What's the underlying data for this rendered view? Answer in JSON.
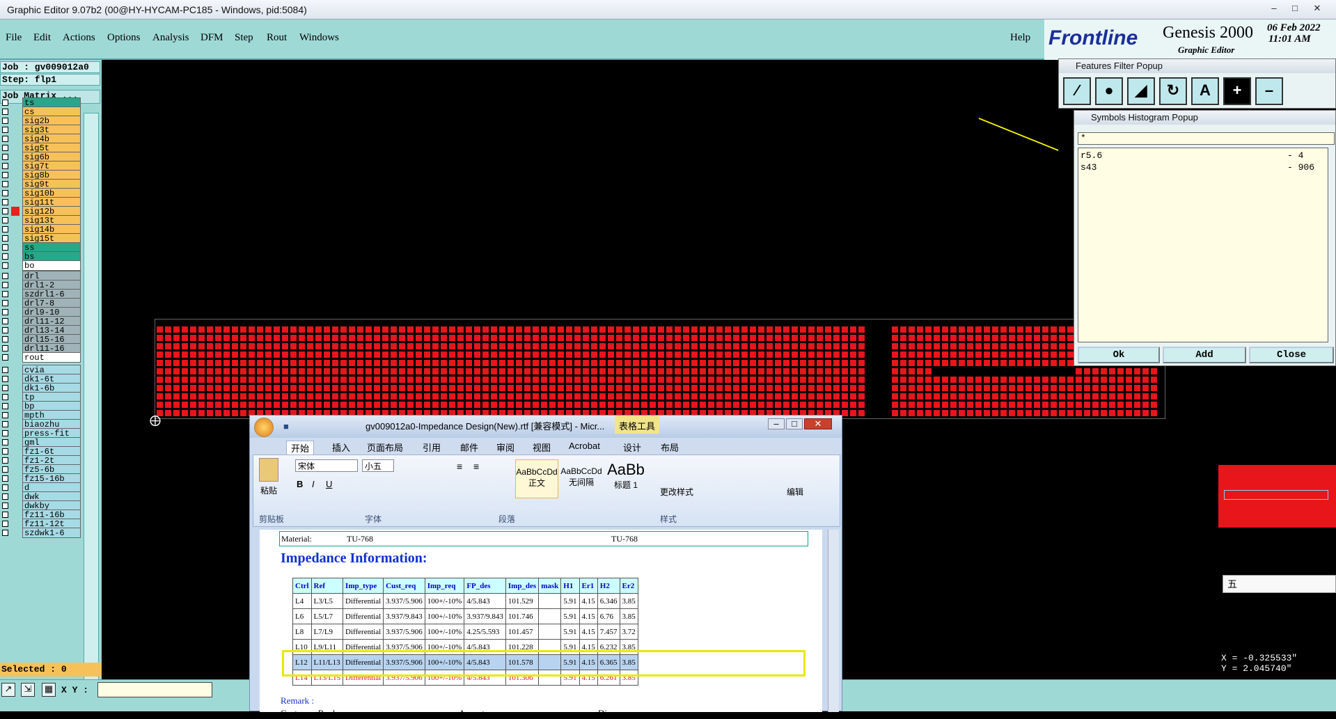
{
  "window": {
    "title": "Graphic Editor 9.07b2 (00@HY-HYCAM-PC185 - Windows, pid:5084)"
  },
  "menu": {
    "items": [
      "File",
      "Edit",
      "Actions",
      "Options",
      "Analysis",
      "DFM",
      "Step",
      "Rout",
      "Windows"
    ],
    "help": "Help"
  },
  "brand": {
    "logo": "Frontline",
    "product": "Genesis 2000",
    "subtitle": "Graphic Editor",
    "date": "06 Feb 2022",
    "time": "11:01 AM"
  },
  "job": {
    "job_label": "Job : gv009012a0",
    "step_label": "Step: flp1",
    "matrix_button": "Job Matrix ..."
  },
  "layers": {
    "group1": [
      "ts",
      "cs",
      "sig2b",
      "sig3t",
      "sig4b",
      "sig5t",
      "sig6b",
      "sig7t",
      "sig8b",
      "sig9t",
      "sig10b",
      "sig11t",
      "sig12b",
      "sig13t",
      "sig14b",
      "sig15t",
      "ss",
      "bs",
      "bo"
    ],
    "group2": [
      "drl",
      "drl1-2",
      "szdrl1-6",
      "drl7-8",
      "drl9-10",
      "drl11-12",
      "drl13-14",
      "drl15-16",
      "drl11-16",
      "rout"
    ],
    "group3": [
      "cvia",
      "dk1-6t",
      "dk1-6b",
      "tp",
      "bp",
      "mpth",
      "biaozhu",
      "press-fit",
      "gml",
      "fz1-6t",
      "fz1-2t",
      "fz5-6b",
      "fz15-16b",
      "d",
      "dwk",
      "dwkby",
      "fz11-16b",
      "fz11-12t",
      "szdwk1-6"
    ],
    "colors": {
      "signal": "#f7c15a",
      "mask": "#26a88a",
      "drill": "#9fb3b8",
      "other": "#a6dbe6",
      "active": "#e82020"
    }
  },
  "status": {
    "selected": "Selected : 0",
    "xy_label": "X Y :"
  },
  "features_popup": {
    "title": "Features Filter Popup",
    "buttons": [
      "line-tool",
      "pad-tool",
      "surface-tool",
      "arc-tool",
      "text-tool",
      "add-tool",
      "remove-tool"
    ]
  },
  "symbols_popup": {
    "title": "Symbols Histogram Popup",
    "filter": "*",
    "entries": [
      {
        "symbol": "r5.6",
        "count": "- 4"
      },
      {
        "symbol": "s43",
        "count": "- 906"
      }
    ],
    "ok": "Ok",
    "add": "Add",
    "close": "Close"
  },
  "coords": {
    "x": "X = -0.325533\"",
    "y": "Y = 2.045740\""
  },
  "ime": {
    "text": "五"
  },
  "word": {
    "title": "gv009012a0-Impedance Design(New).rtf [兼容模式] - Micr...",
    "tools_tab": "表格工具",
    "tabs": [
      "开始",
      "插入",
      "页面布局",
      "引用",
      "邮件",
      "审阅",
      "视图",
      "Acrobat",
      "设计",
      "布局"
    ],
    "font_name": "宋体",
    "font_size": "小五",
    "groups": [
      "剪贴板",
      "字体",
      "段落",
      "样式",
      "编辑"
    ],
    "paste_label": "粘贴",
    "styles": [
      "AaBbCcDd",
      "AaBbCcDd",
      "AaBb"
    ],
    "style_names": [
      "正文",
      "无间隔",
      "标题 1"
    ],
    "change_style": "更改样式",
    "edit": "编辑",
    "material_label": "Material:",
    "material_value": "TU-768",
    "material_value2": "TU-768",
    "heading": "Impedance Information:",
    "remark": "Remark :",
    "reply": "Customer Reply:",
    "accept": "Accept:",
    "disapprove": "Disapprove:",
    "table_headers": [
      "Ctrl",
      "Ref",
      "Imp_type",
      "Cust_req",
      "Imp_req",
      "FP_des",
      "Imp_des",
      "mask",
      "H1",
      "Er1",
      "H2",
      "Er2"
    ],
    "table_rows": [
      [
        "L4",
        "L3/L5",
        "Differential",
        "3.937/5.906",
        "100+/-10%",
        "4/5.843",
        "101.529",
        "",
        "5.91",
        "4.15",
        "6.346",
        "3.85"
      ],
      [
        "L6",
        "L5/L7",
        "Differential",
        "3.937/9.843",
        "100+/-10%",
        "3.937/9.843",
        "101.746",
        "",
        "5.91",
        "4.15",
        "6.76",
        "3.85"
      ],
      [
        "L8",
        "L7/L9",
        "Differential",
        "3.937/5.906",
        "100+/-10%",
        "4.25/5.593",
        "101.457",
        "",
        "5.91",
        "4.15",
        "7.457",
        "3.72"
      ],
      [
        "L10",
        "L9/L11",
        "Differential",
        "3.937/5.906",
        "100+/-10%",
        "4/5.843",
        "101.228",
        "",
        "5.91",
        "4.15",
        "6.232",
        "3.85"
      ],
      [
        "L12",
        "L11/L13",
        "Differential",
        "3.937/5.906",
        "100+/-10%",
        "4/5.843",
        "101.578",
        "",
        "5.91",
        "4.15",
        "6.365",
        "3.85"
      ],
      [
        "L14",
        "L13/L15",
        "Differential",
        "3.937/5.906",
        "100+/-10%",
        "4/5.843",
        "101.306",
        "",
        "5.91",
        "4.15",
        "6.261",
        "3.85"
      ]
    ]
  }
}
